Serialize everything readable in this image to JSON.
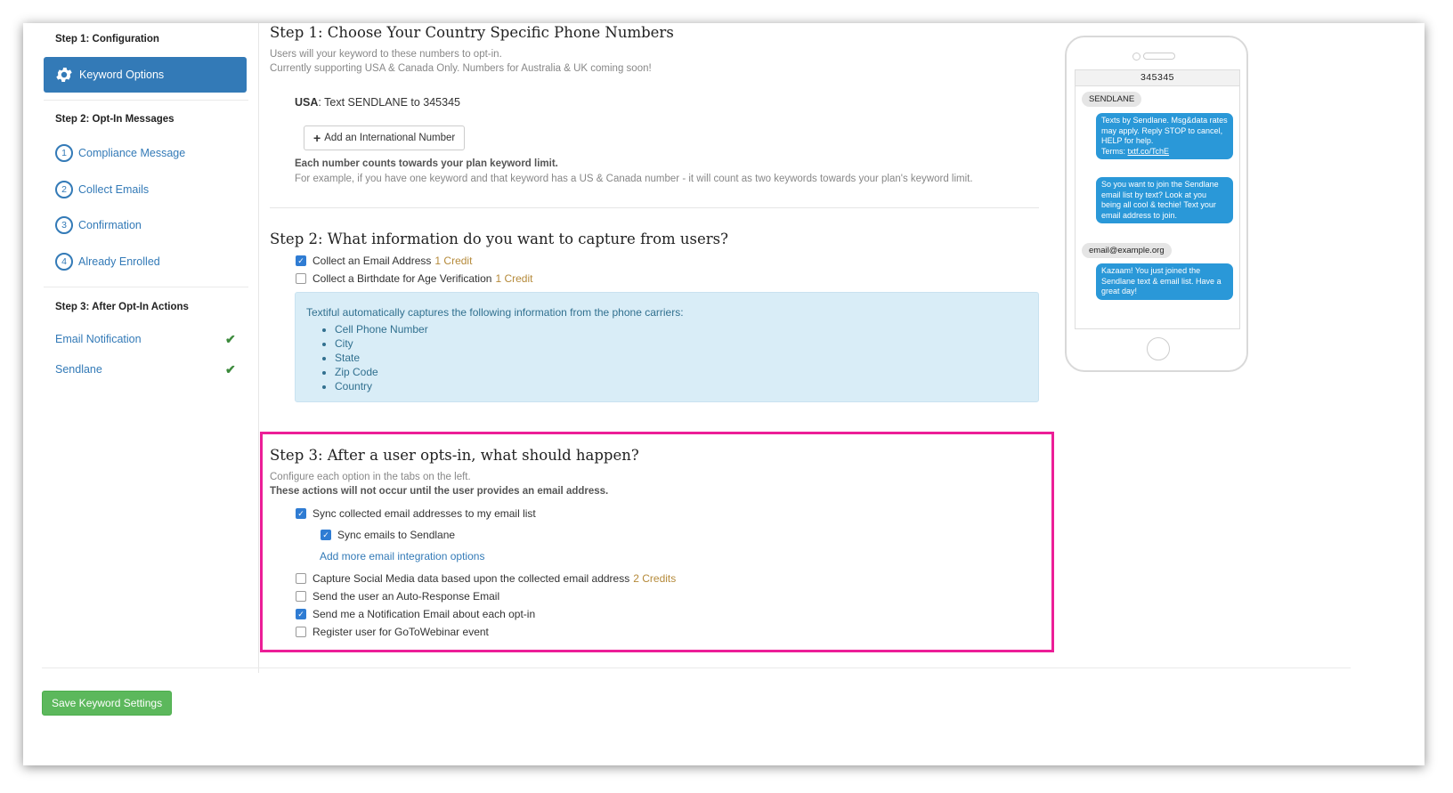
{
  "sidebar": {
    "step1_heading": "Step 1: Configuration",
    "active_item": "Keyword Options",
    "step2_heading": "Step 2: Opt-In Messages",
    "step2_items": [
      {
        "num": "1",
        "label": "Compliance Message"
      },
      {
        "num": "2",
        "label": "Collect Emails"
      },
      {
        "num": "3",
        "label": "Confirmation"
      },
      {
        "num": "4",
        "label": "Already Enrolled"
      }
    ],
    "step3_heading": "Step 3: After Opt-In Actions",
    "step3_items": [
      {
        "label": "Email Notification",
        "check": "✔"
      },
      {
        "label": "Sendlane",
        "check": "✔"
      }
    ]
  },
  "step1": {
    "title": "Step 1: Choose Your Country Specific Phone Numbers",
    "desc1": "Users will your keyword to these numbers to opt-in.",
    "desc2": "Currently supporting USA & Canada Only. Numbers for Australia & UK coming soon!",
    "usa_label": "USA",
    "usa_text": ": Text SENDLANE to 345345",
    "add_button": "Add an International Number",
    "limit_bold": "Each number counts towards your plan keyword limit.",
    "limit_text": "For example, if you have one keyword and that keyword has a US & Canada number - it will count as two keywords towards your plan's keyword limit."
  },
  "step2": {
    "title": "Step 2: What information do you want to capture from users?",
    "options": [
      {
        "label": "Collect an Email Address",
        "credit": "1 Credit",
        "checked": true
      },
      {
        "label": "Collect a Birthdate for Age Verification",
        "credit": "1 Credit",
        "checked": false
      }
    ],
    "info_intro": "Textiful automatically captures the following information from the phone carriers:",
    "info_items": [
      "Cell Phone Number",
      "City",
      "State",
      "Zip Code",
      "Country"
    ]
  },
  "step3": {
    "title": "Step 3: After a user opts-in, what should happen?",
    "desc": "Configure each option in the tabs on the left.",
    "desc_bold": "These actions will not occur until the user provides an email address.",
    "sync_label": "Sync collected email addresses to my email list",
    "sync_sendlane": "Sync emails to Sendlane",
    "more_link": "Add more email integration options",
    "social_label": "Capture Social Media data based upon the collected email address",
    "social_credit": "2 Credits",
    "autoresponse_label": "Send the user an Auto-Response Email",
    "notification_label": "Send me a Notification Email about each opt-in",
    "webinar_label": "Register user for GoToWebinar event"
  },
  "save_button": "Save Keyword Settings",
  "phone": {
    "number": "345345",
    "incoming1": "SENDLANE",
    "outgoing1": "Texts by Sendlane. Msg&data rates may apply. Reply STOP to cancel, HELP for help.",
    "outgoing1_terms": "Terms: ",
    "outgoing1_link": "txtf.co/TchE",
    "outgoing2": "So you want to join the Sendlane email list by text? Look at you being all cool & techie! Text your email address to join.",
    "incoming2": "email@example.org",
    "outgoing3": "Kazaam! You just joined the Sendlane text & email list. Have a great day!"
  },
  "colors": {
    "primary": "#337ab7",
    "success": "#5cb85c",
    "highlight": "#ec1e97",
    "info_bg": "#d9edf7",
    "bubble_blue": "#2a98d8"
  }
}
